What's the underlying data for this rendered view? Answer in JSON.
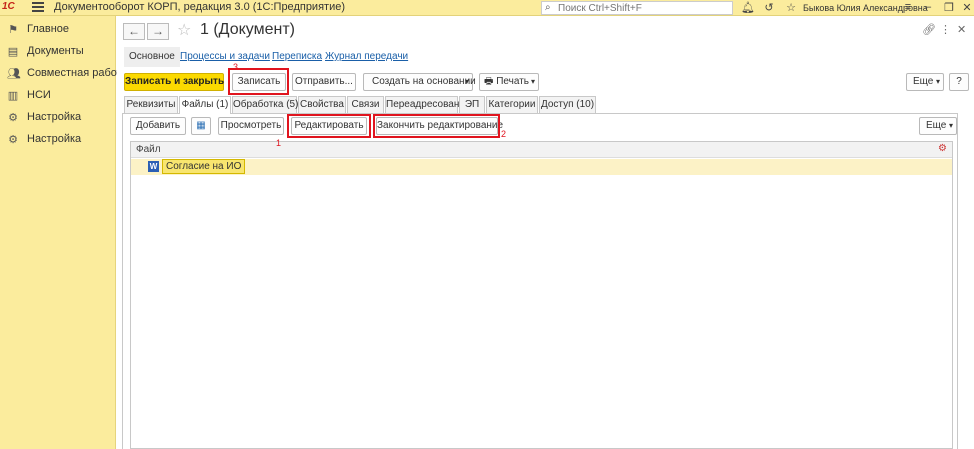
{
  "titlebar": {
    "logo": "1С",
    "app_title": "Документооборот КОРП, редакция 3.0  (1С:Предприятие)",
    "search_placeholder": "Поиск Ctrl+Shift+F",
    "user": "Быкова Юлия Александровна"
  },
  "sidebar": {
    "items": [
      {
        "label": "Главное",
        "icon": "flag-icon"
      },
      {
        "label": "Документы",
        "icon": "document-icon"
      },
      {
        "label": "Совместная работа",
        "icon": "people-icon"
      },
      {
        "label": "НСИ",
        "icon": "book-icon"
      },
      {
        "label": "Настройка",
        "icon": "gear-icon"
      },
      {
        "label": "Настройка",
        "icon": "gear-icon"
      }
    ]
  },
  "document": {
    "title": "1 (Документ)"
  },
  "nav_tabs": [
    "Основное",
    "Процессы и задачи",
    "Переписка",
    "Журнал передачи"
  ],
  "toolbar": {
    "save_close": "Записать и закрыть",
    "save": "Записать",
    "send": "Отправить...",
    "create_based": "Создать на основании",
    "print": "Печать",
    "more": "Еще",
    "help": "?"
  },
  "tabs": [
    "Реквизиты",
    "Файлы (1)",
    "Обработка (5)",
    "Свойства",
    "Связи",
    "Переадресован",
    "ЭП",
    "Категории",
    "Доступ (10)"
  ],
  "files_toolbar": {
    "add": "Добавить",
    "view": "Просмотреть",
    "edit": "Редактировать",
    "finish_edit": "Закончить редактирование",
    "more": "Еще"
  },
  "files_table": {
    "column_header": "Файл",
    "rows": [
      "Согласие на ИО"
    ]
  },
  "annotations": [
    "3",
    "1",
    "2"
  ],
  "colors": {
    "sidebar_bg": "#fbec9d",
    "primary_button": "#fbd900",
    "highlight": "#e0141e",
    "link": "#1a5fa8"
  }
}
